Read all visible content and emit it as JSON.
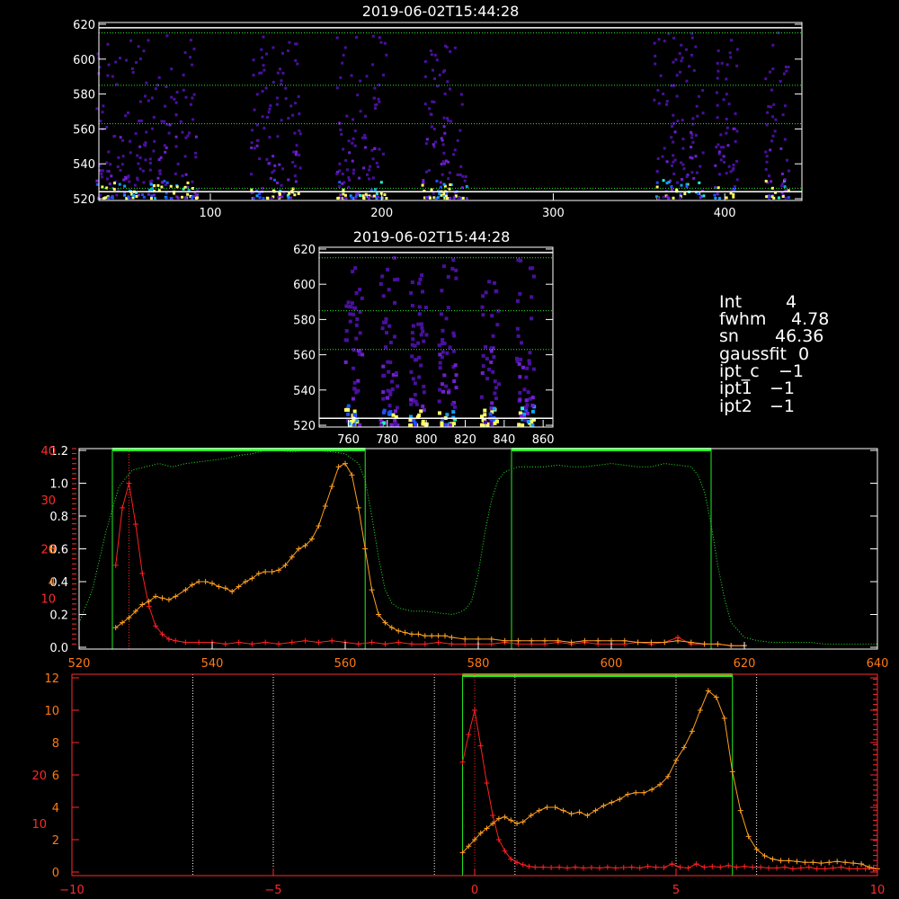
{
  "colors": {
    "red": "#ff2020",
    "orange": "#ffa020",
    "green": "#22ee22",
    "axis_red": "#ff2a2a",
    "axis_orange": "#ff7a10",
    "white": "#ffffff"
  },
  "info_panel": [
    {
      "key": "Int",
      "value": "4"
    },
    {
      "key": "fwhm",
      "value": "4.78"
    },
    {
      "key": "sn",
      "value": "46.36"
    },
    {
      "key": "gaussfit",
      "value": "0"
    },
    {
      "key": "ipt_c",
      "value": "−1"
    },
    {
      "key": "ipt1",
      "value": "−1"
    },
    {
      "key": "ipt2",
      "value": "−1"
    }
  ],
  "chart_data": [
    {
      "type": "heatmap",
      "title": "2019-06-02T15:44:28",
      "xlim": [
        35,
        445
      ],
      "ylim": [
        519,
        621
      ],
      "xticks": [
        "100",
        "200",
        "300",
        "400"
      ],
      "yticks": [
        "520",
        "540",
        "560",
        "580",
        "600",
        "620"
      ],
      "hlines_white": [
        524,
        618
      ],
      "hlines_dotted": [
        526,
        563,
        585,
        615
      ],
      "column_clusters": [
        40,
        55,
        70,
        85,
        130,
        145,
        180,
        195,
        230,
        242,
        365,
        380,
        400,
        430
      ],
      "colormap": "rainbow"
    },
    {
      "type": "heatmap",
      "title": "2019-06-02T15:44:28",
      "xlim": [
        745,
        865
      ],
      "ylim": [
        519,
        621
      ],
      "xticks": [
        "760",
        "780",
        "800",
        "820",
        "840",
        "860"
      ],
      "yticks": [
        "520",
        "540",
        "560",
        "580",
        "600",
        "620"
      ],
      "hlines_white": [
        524,
        618
      ],
      "hlines_dotted": [
        563,
        585,
        615
      ],
      "column_clusters": [
        762,
        780,
        795,
        810,
        832,
        850
      ],
      "colormap": "rainbow"
    },
    {
      "type": "line",
      "xlim": [
        520,
        640
      ],
      "xticks": [
        "520",
        "540",
        "560",
        "580",
        "600",
        "620",
        "640"
      ],
      "left_axis_white": {
        "ylim": [
          0,
          1.2
        ],
        "ticks": [
          "0.0",
          "0.2",
          "0.4",
          "0.6",
          "0.8",
          "1.0",
          "1.2"
        ]
      },
      "left_axis_red": {
        "ylim": [
          0,
          40
        ],
        "ticks": [
          "10",
          "20",
          "30",
          "40"
        ]
      },
      "left_axis_orange": {
        "ylim": [
          0,
          12
        ],
        "ticks": [
          "4",
          "6"
        ]
      },
      "green_bands": [
        [
          525,
          563
        ],
        [
          585,
          615
        ]
      ],
      "green_top_bar": [
        [
          525,
          563
        ],
        [
          585,
          615
        ]
      ],
      "red_dotted_x": 527.5,
      "series": [
        {
          "color": "red",
          "x": [
            525.5,
            526.5,
            527.5,
            528.5,
            529.5,
            530.5,
            531.5,
            532.5,
            533.5,
            534.5,
            536,
            538,
            540,
            542,
            544,
            546,
            548,
            550,
            552,
            554,
            556,
            558,
            560,
            562,
            564,
            566,
            568,
            570,
            572,
            574,
            576,
            578,
            580,
            582,
            584,
            586,
            588,
            590,
            592,
            594,
            596,
            598,
            600,
            602,
            604,
            606,
            608,
            610,
            612,
            614,
            616,
            618,
            620
          ],
          "y": [
            0.5,
            0.85,
            1.0,
            0.75,
            0.45,
            0.25,
            0.13,
            0.08,
            0.05,
            0.04,
            0.03,
            0.03,
            0.03,
            0.02,
            0.03,
            0.02,
            0.03,
            0.02,
            0.03,
            0.04,
            0.03,
            0.04,
            0.03,
            0.02,
            0.03,
            0.02,
            0.03,
            0.02,
            0.02,
            0.03,
            0.02,
            0.02,
            0.02,
            0.02,
            0.03,
            0.02,
            0.02,
            0.02,
            0.03,
            0.02,
            0.03,
            0.02,
            0.02,
            0.02,
            0.03,
            0.02,
            0.03,
            0.06,
            0.02,
            0.02,
            0.02,
            0.01,
            0.01
          ]
        },
        {
          "color": "orange",
          "x": [
            525.5,
            526.5,
            527.5,
            528.5,
            529.5,
            530.5,
            531.5,
            532.5,
            533.5,
            534.5,
            536,
            537,
            538,
            539,
            540,
            541,
            542,
            543,
            544,
            545,
            546,
            547,
            548,
            549,
            550,
            551,
            552,
            553,
            554,
            555,
            556,
            557,
            558,
            559,
            560,
            561,
            562,
            563,
            564,
            565,
            566,
            567,
            568,
            569,
            570,
            571,
            572,
            573,
            574,
            575,
            576,
            578,
            580,
            582,
            584,
            586,
            588,
            590,
            592,
            594,
            596,
            598,
            600,
            602,
            604,
            606,
            608,
            610,
            612,
            614,
            616,
            618,
            620
          ],
          "y": [
            0.12,
            0.15,
            0.18,
            0.22,
            0.26,
            0.28,
            0.31,
            0.3,
            0.29,
            0.31,
            0.35,
            0.38,
            0.4,
            0.4,
            0.39,
            0.37,
            0.36,
            0.34,
            0.37,
            0.4,
            0.42,
            0.45,
            0.46,
            0.46,
            0.47,
            0.5,
            0.55,
            0.6,
            0.62,
            0.66,
            0.74,
            0.86,
            0.98,
            1.1,
            1.12,
            1.05,
            0.85,
            0.6,
            0.35,
            0.2,
            0.15,
            0.12,
            0.1,
            0.09,
            0.08,
            0.08,
            0.07,
            0.07,
            0.07,
            0.07,
            0.06,
            0.05,
            0.05,
            0.05,
            0.04,
            0.04,
            0.04,
            0.04,
            0.04,
            0.03,
            0.04,
            0.04,
            0.04,
            0.04,
            0.03,
            0.03,
            0.03,
            0.04,
            0.03,
            0.02,
            0.02,
            0.01,
            0.01
          ]
        },
        {
          "color": "green",
          "style": "dotted",
          "x": [
            520,
            522,
            524,
            526,
            528,
            530,
            532,
            534,
            536,
            538,
            540,
            542,
            544,
            546,
            548,
            550,
            552,
            554,
            556,
            558,
            560,
            562,
            563,
            564,
            565,
            566,
            567,
            568,
            570,
            572,
            574,
            576,
            577,
            578,
            579,
            580,
            581,
            582,
            583,
            584,
            586,
            588,
            590,
            592,
            594,
            596,
            598,
            600,
            602,
            604,
            606,
            608,
            610,
            612,
            613,
            614,
            615,
            616,
            617,
            618,
            620,
            622,
            624,
            626,
            628,
            630,
            632,
            634,
            636,
            638,
            640
          ],
          "y": [
            0.15,
            0.35,
            0.7,
            0.98,
            1.08,
            1.1,
            1.12,
            1.1,
            1.12,
            1.13,
            1.14,
            1.15,
            1.17,
            1.18,
            1.2,
            1.2,
            1.19,
            1.2,
            1.2,
            1.19,
            1.18,
            1.12,
            1.02,
            0.8,
            0.55,
            0.35,
            0.27,
            0.24,
            0.22,
            0.22,
            0.21,
            0.2,
            0.21,
            0.23,
            0.28,
            0.45,
            0.7,
            0.9,
            1.02,
            1.07,
            1.1,
            1.1,
            1.1,
            1.11,
            1.1,
            1.1,
            1.11,
            1.12,
            1.11,
            1.1,
            1.1,
            1.12,
            1.11,
            1.1,
            1.05,
            0.95,
            0.75,
            0.5,
            0.3,
            0.15,
            0.06,
            0.04,
            0.03,
            0.03,
            0.03,
            0.03,
            0.02,
            0.02,
            0.02,
            0.02,
            0.02
          ]
        }
      ]
    },
    {
      "type": "line",
      "xlim": [
        -10,
        10
      ],
      "xticks": [
        "−10",
        "−5",
        "0",
        "5",
        "10"
      ],
      "left_axis_red": {
        "ylim": [
          0,
          40
        ],
        "ticks": [
          "10",
          "20"
        ]
      },
      "left_axis_orange": {
        "ylim": [
          0,
          12
        ],
        "ticks": [
          "0",
          "2",
          "4",
          "6",
          "8",
          "10",
          "12"
        ]
      },
      "green_band": [
        -0.3,
        6.4
      ],
      "vlines_dotted_white": [
        -7,
        -5,
        -1,
        1,
        5,
        7
      ],
      "red_dotted_x": 0,
      "series": [
        {
          "color": "red",
          "x": [
            -0.3,
            -0.15,
            0,
            0.15,
            0.3,
            0.45,
            0.6,
            0.75,
            0.9,
            1.05,
            1.2,
            1.35,
            1.5,
            1.7,
            1.9,
            2.1,
            2.3,
            2.5,
            2.7,
            2.9,
            3.1,
            3.3,
            3.5,
            3.7,
            3.9,
            4.1,
            4.3,
            4.5,
            4.7,
            4.9,
            5.1,
            5.3,
            5.5,
            5.7,
            5.9,
            6.1,
            6.3,
            6.5,
            6.7,
            6.9,
            7.1,
            7.3,
            7.5,
            7.7,
            7.9,
            8.1,
            8.3,
            8.5,
            8.7,
            8.9,
            9.1,
            9.3,
            9.5,
            9.7,
            9.9
          ],
          "y": [
            6.8,
            8.5,
            10,
            7.8,
            5.5,
            3.5,
            2,
            1.3,
            0.8,
            0.6,
            0.45,
            0.35,
            0.3,
            0.3,
            0.28,
            0.3,
            0.25,
            0.3,
            0.25,
            0.28,
            0.25,
            0.3,
            0.25,
            0.28,
            0.3,
            0.25,
            0.35,
            0.3,
            0.28,
            0.5,
            0.3,
            0.25,
            0.5,
            0.3,
            0.35,
            0.3,
            0.4,
            0.3,
            0.35,
            0.3,
            0.3,
            0.25,
            0.25,
            0.3,
            0.2,
            0.25,
            0.3,
            0.2,
            0.2,
            0.25,
            0.3,
            0.2,
            0.2,
            0.2,
            0.2
          ]
        },
        {
          "color": "orange",
          "x": [
            -0.3,
            -0.15,
            0,
            0.15,
            0.3,
            0.45,
            0.6,
            0.75,
            0.9,
            1.05,
            1.2,
            1.4,
            1.6,
            1.8,
            2.0,
            2.2,
            2.4,
            2.6,
            2.8,
            3.0,
            3.2,
            3.4,
            3.6,
            3.8,
            4.0,
            4.2,
            4.4,
            4.6,
            4.8,
            5.0,
            5.2,
            5.4,
            5.6,
            5.8,
            6.0,
            6.2,
            6.4,
            6.6,
            6.8,
            7.0,
            7.2,
            7.4,
            7.6,
            7.8,
            8.0,
            8.2,
            8.4,
            8.6,
            8.8,
            9.0,
            9.2,
            9.4,
            9.6,
            9.8,
            10.0
          ],
          "y": [
            1.2,
            1.6,
            2.0,
            2.4,
            2.7,
            3.0,
            3.3,
            3.4,
            3.2,
            3.0,
            3.1,
            3.5,
            3.8,
            4.0,
            4.0,
            3.8,
            3.6,
            3.7,
            3.5,
            3.8,
            4.1,
            4.3,
            4.5,
            4.8,
            4.9,
            4.9,
            5.1,
            5.4,
            5.9,
            6.9,
            7.7,
            8.7,
            10,
            11.2,
            10.8,
            9.5,
            6.2,
            3.8,
            2.2,
            1.4,
            1.0,
            0.8,
            0.7,
            0.7,
            0.65,
            0.6,
            0.6,
            0.55,
            0.6,
            0.65,
            0.6,
            0.55,
            0.5,
            0.3,
            0.2
          ]
        }
      ]
    }
  ]
}
